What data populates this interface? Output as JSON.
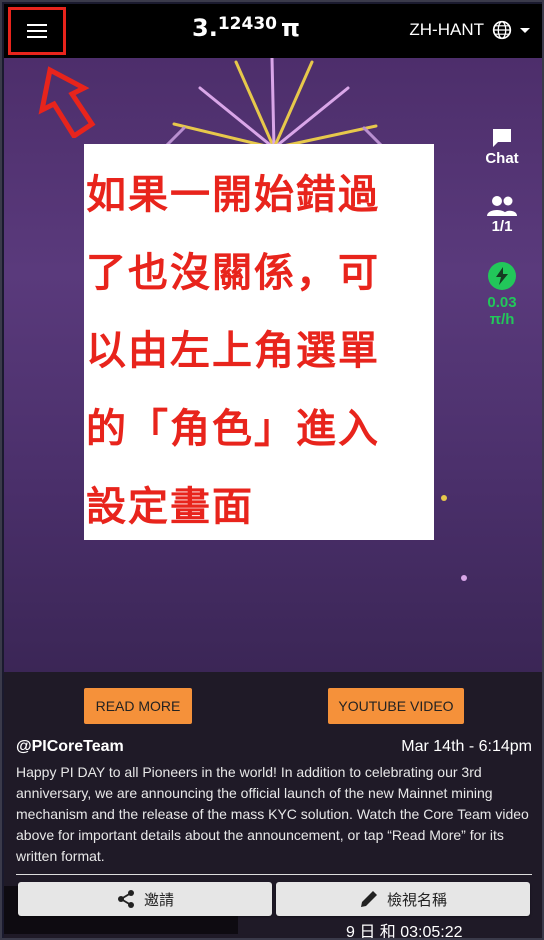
{
  "header": {
    "balance_int": "3.",
    "balance_dec": "12430",
    "balance_unit": "π",
    "language": "ZH-HANT",
    "menu_icon": "hamburger-menu-icon"
  },
  "side": {
    "chat_label": "Chat",
    "members_value": "1/1",
    "rate_value": "0.03",
    "rate_unit": "π/h"
  },
  "annotation": {
    "lines": [
      "如果一開始錯過",
      "了也沒關係，可",
      "以由左上角選單",
      "的「角色」進入",
      "設定畫面"
    ]
  },
  "news": {
    "read_more_label": "READ MORE",
    "youtube_label": "YOUTUBE VIDEO",
    "author": "@PICoreTeam",
    "timestamp": "Mar 14th - 6:14pm",
    "body": "Happy PI DAY to all Pioneers in the world! In addition to celebrating our 3rd anniversary, we are announcing the official launch of the new Mainnet mining mechanism and the release of the mass KYC solution. Watch the Core Team video above for important details about the announcement, or tap “Read More” for its written format."
  },
  "actions": {
    "invite_label": "邀請",
    "nickname_label": "檢視名稱"
  },
  "footer": {
    "session_time": "9 日 和 03:05:22"
  },
  "colors": {
    "accent_orange": "#f5913a",
    "annotation_red": "#e8241c",
    "rate_green": "#22c75a"
  }
}
